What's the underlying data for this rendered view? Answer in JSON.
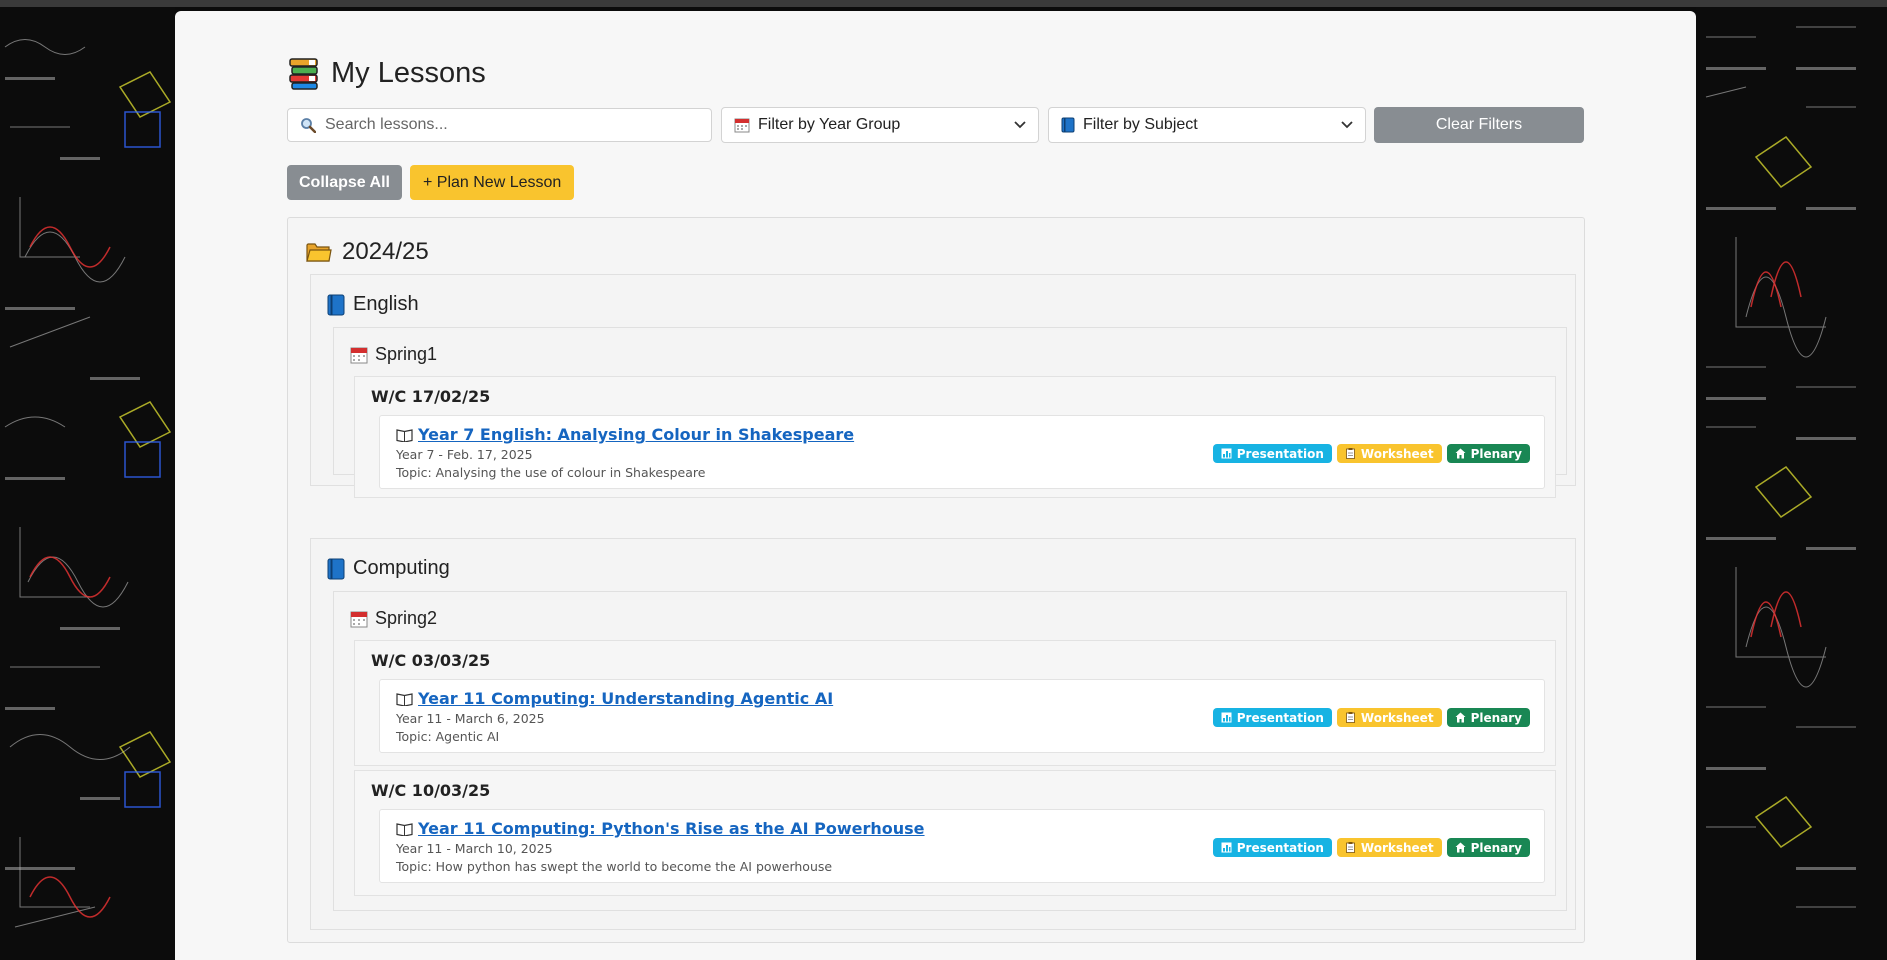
{
  "page": {
    "title": "My Lessons"
  },
  "filters": {
    "search_placeholder": "Search lessons...",
    "year_group_label": "Filter by Year Group",
    "subject_label": "Filter by Subject",
    "clear_label": "Clear Filters"
  },
  "actions": {
    "collapse_label": "Collapse All",
    "plan_label": "+ Plan New Lesson"
  },
  "year": {
    "label": "2024/25",
    "subjects": [
      {
        "name": "English",
        "terms": [
          {
            "name": "Spring1",
            "weeks": [
              {
                "label": "W/C 17/02/25",
                "lessons": [
                  {
                    "title": "Year 7 English: Analysing Colour in Shakespeare",
                    "meta": "Year 7 - Feb. 17, 2025",
                    "topic": "Topic: Analysing the use of colour in Shakespeare"
                  }
                ]
              }
            ]
          }
        ]
      },
      {
        "name": "Computing",
        "terms": [
          {
            "name": "Spring2",
            "weeks": [
              {
                "label": "W/C 03/03/25",
                "lessons": [
                  {
                    "title": "Year 11 Computing: Understanding Agentic AI",
                    "meta": "Year 11 - March 6, 2025",
                    "topic": "Topic: Agentic AI"
                  }
                ]
              },
              {
                "label": "W/C 10/03/25",
                "lessons": [
                  {
                    "title": "Year 11 Computing: Python's Rise as the AI Powerhouse",
                    "meta": "Year 11 - March 10, 2025",
                    "topic": "Topic: How python has swept the world to become the AI powerhouse"
                  }
                ]
              }
            ]
          }
        ]
      }
    ]
  },
  "badges": {
    "presentation": "Presentation",
    "worksheet": "Worksheet",
    "plenary": "Plenary"
  },
  "colors": {
    "link": "#1565c0",
    "presentation": "#17b3e3",
    "worksheet": "#f9c42e",
    "plenary": "#198754",
    "button_grey": "#888d92",
    "button_yellow": "#f9c42e"
  },
  "icons": {
    "title": "books-icon",
    "year": "folder-icon",
    "subject": "blue-book-icon",
    "term": "calendar-icon",
    "lesson": "open-book-icon",
    "search": "magnifier-icon"
  }
}
